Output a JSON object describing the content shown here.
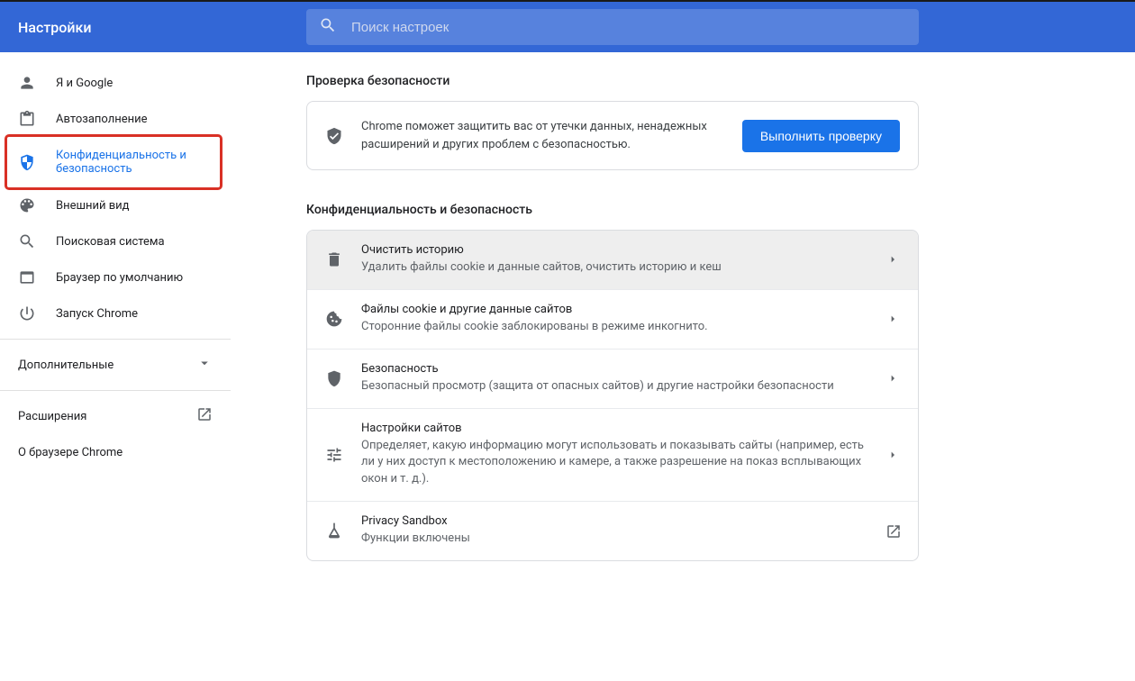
{
  "header": {
    "title": "Настройки",
    "search_placeholder": "Поиск настроек"
  },
  "sidebar": {
    "items": [
      {
        "id": "me-google",
        "label": "Я и Google"
      },
      {
        "id": "autofill",
        "label": "Автозаполнение"
      },
      {
        "id": "privacy",
        "label": "Конфиденциальность и безопасность",
        "active": true,
        "highlighted": true
      },
      {
        "id": "appearance",
        "label": "Внешний вид"
      },
      {
        "id": "search-engine",
        "label": "Поисковая система"
      },
      {
        "id": "default-browser",
        "label": "Браузер по умолчанию"
      },
      {
        "id": "startup",
        "label": "Запуск Chrome"
      }
    ],
    "advanced_label": "Дополнительные",
    "extensions_label": "Расширения",
    "about_label": "О браузере Chrome"
  },
  "safety_check": {
    "heading": "Проверка безопасности",
    "description": "Chrome поможет защитить вас от утечки данных, ненадежных расширений и других проблем с безопасностью.",
    "button": "Выполнить проверку"
  },
  "privacy_section": {
    "heading": "Конфиденциальность и безопасность",
    "rows": [
      {
        "id": "clear-data",
        "title": "Очистить историю",
        "subtitle": "Удалить файлы cookie и данные сайтов, очистить историю и кеш",
        "hovered": true,
        "link": "internal"
      },
      {
        "id": "cookies",
        "title": "Файлы cookie и другие данные сайтов",
        "subtitle": "Сторонние файлы cookie заблокированы в режиме инкогнито.",
        "link": "internal"
      },
      {
        "id": "security",
        "title": "Безопасность",
        "subtitle": "Безопасный просмотр (защита от опасных сайтов) и другие настройки безопасности",
        "link": "internal"
      },
      {
        "id": "site-settings",
        "title": "Настройки сайтов",
        "subtitle": "Определяет, какую информацию могут использовать и показывать сайты (например, есть ли у них доступ к местоположению и камере, а также разрешение на показ всплывающих окон и т. д.).",
        "link": "internal"
      },
      {
        "id": "privacy-sandbox",
        "title": "Privacy Sandbox",
        "subtitle": "Функции включены",
        "link": "external"
      }
    ]
  }
}
